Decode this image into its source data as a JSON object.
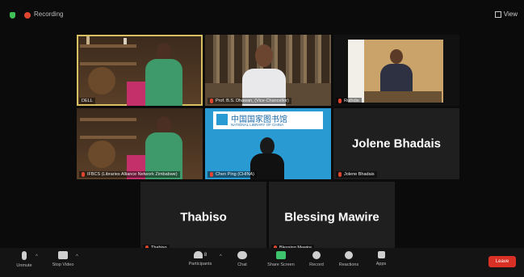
{
  "topbar": {
    "recording_label": "Recording",
    "view_label": "View"
  },
  "tiles": [
    {
      "name": "DELL",
      "bind": "t0"
    },
    {
      "name": "Prof. B.S. Dhawan, (Vice-Chancellor)",
      "bind": "t1"
    },
    {
      "name": "Ruthdie",
      "bind": "t2"
    },
    {
      "name": "IFBCS (Libraries Alliance Network Zimbabwe)",
      "bind": "t3"
    },
    {
      "name": "Chen Ping (CHINA)",
      "bind": "t4"
    },
    {
      "name": "Jolene Bhadais",
      "big": "Jolene Bhadais"
    },
    {
      "name": "Thabiso",
      "big": "Thabiso"
    },
    {
      "name": "Blessing Mawire",
      "big": "Blessing Mawire"
    }
  ],
  "library_banner": {
    "chinese": "中国国家图书馆",
    "english": "NATIONAL LIBRARY OF CHINA"
  },
  "toolbar": {
    "unmute": "Unmute",
    "stop_video": "Stop Video",
    "participants": "Participants",
    "participants_count": "8",
    "chat": "Chat",
    "share_screen": "Share Screen",
    "record": "Record",
    "reactions": "Reactions",
    "apps": "Apps",
    "leave": "Leave"
  },
  "colors": {
    "active_outline": "#d8c060",
    "leave": "#d93025",
    "share": "#3ec46d",
    "muted": "#e0452e"
  }
}
